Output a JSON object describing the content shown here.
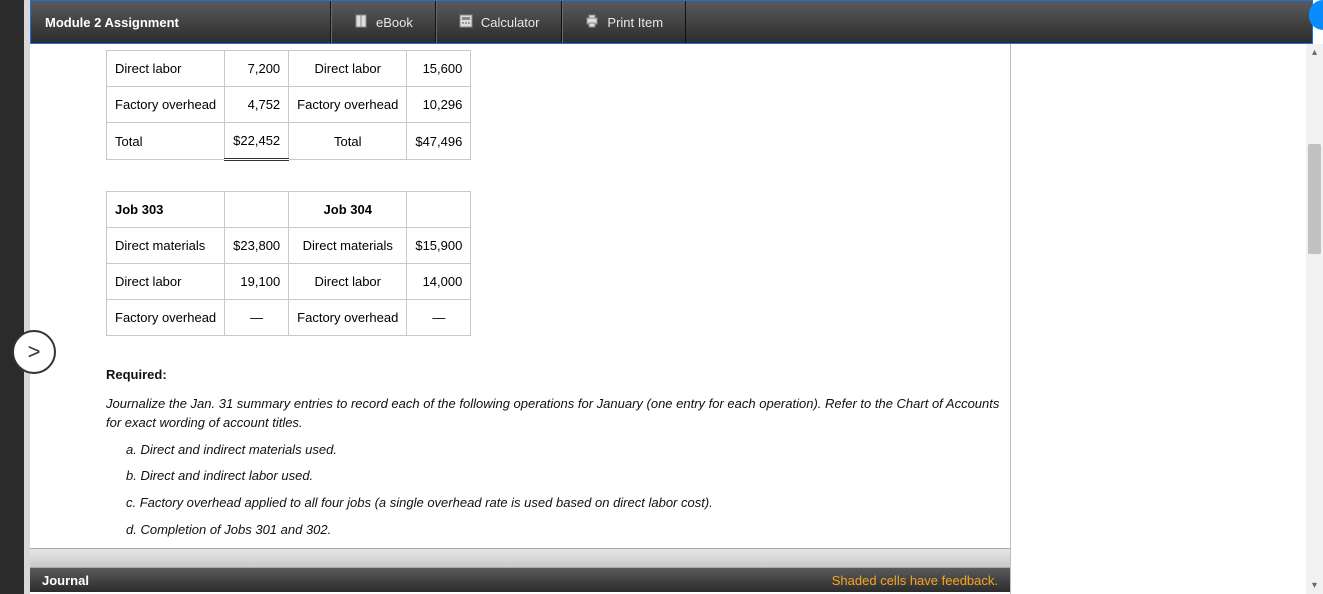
{
  "header": {
    "title": "Module 2 Assignment",
    "buttons": {
      "ebook": "eBook",
      "calculator": "Calculator",
      "print": "Print Item"
    }
  },
  "expand_glyph": ">",
  "table_top": {
    "rows": [
      {
        "l1": "Direct labor",
        "v1": "7,200",
        "l2": "Direct labor",
        "v2": "15,600"
      },
      {
        "l1": "Factory overhead",
        "v1": "4,752",
        "l2": "Factory overhead",
        "v2": "10,296"
      },
      {
        "l1": "Total",
        "v1": "$22,452",
        "l2": "Total",
        "v2": "$47,496",
        "is_total": true
      }
    ]
  },
  "table_bottom": {
    "headers": {
      "h1": "Job 303",
      "h2": "Job 304"
    },
    "rows": [
      {
        "l1": "Direct materials",
        "v1": "$23,800",
        "l2": "Direct materials",
        "v2": "$15,900"
      },
      {
        "l1": "Direct labor",
        "v1": "19,100",
        "l2": "Direct labor",
        "v2": "14,000"
      },
      {
        "l1": "Factory overhead",
        "v1": "—",
        "l2": "Factory overhead",
        "v2": "—"
      }
    ]
  },
  "requirements": {
    "label": "Required:",
    "intro": "Journalize the Jan. 31 summary entries to record each of the following operations for January (one entry for each operation). Refer to the Chart of Accounts for exact wording of account titles.",
    "items": [
      "a. Direct and indirect materials used.",
      "b. Direct and indirect labor used.",
      "c. Factory overhead applied to all four jobs (a single overhead rate is used based on direct labor cost).",
      "d. Completion of Jobs 301 and 302."
    ]
  },
  "journal": {
    "title": "Journal",
    "feedback": "Shaded cells have feedback."
  }
}
